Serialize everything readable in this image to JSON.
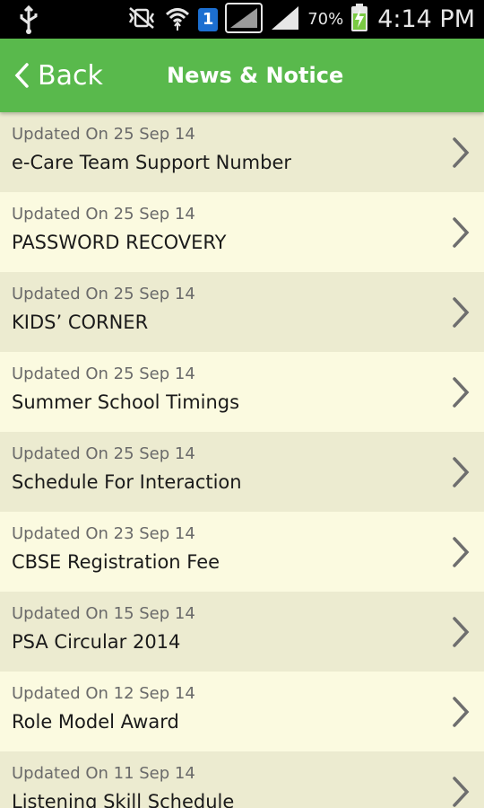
{
  "status_bar": {
    "icons": [
      "usb-icon",
      "muted-vibrate-icon",
      "wifi-icon",
      "sim-badge-icon",
      "signal-1-icon",
      "signal-2-icon",
      "battery-charging-icon"
    ],
    "sim_badge": "1",
    "battery_percent": "70%",
    "time": "4:14 PM"
  },
  "header": {
    "back_label": "Back",
    "title": "News & Notice",
    "accent_color": "#59b94c"
  },
  "news": {
    "items": [
      {
        "date": "Updated On 25 Sep 14",
        "title": "e-Care Team Support Number"
      },
      {
        "date": "Updated On 25 Sep 14",
        "title": "PASSWORD RECOVERY"
      },
      {
        "date": "Updated On 25 Sep 14",
        "title": "KIDS’ CORNER"
      },
      {
        "date": "Updated On 25 Sep 14",
        "title": "Summer School Timings"
      },
      {
        "date": "Updated On 25 Sep 14",
        "title": "Schedule For Interaction"
      },
      {
        "date": "Updated On 23 Sep 14",
        "title": "CBSE Registration Fee"
      },
      {
        "date": "Updated On 15 Sep 14",
        "title": "PSA Circular 2014"
      },
      {
        "date": "Updated On 12 Sep 14",
        "title": "Role Model Award"
      },
      {
        "date": "Updated On 11 Sep 14",
        "title": "Listening Skill Schedule"
      }
    ]
  }
}
